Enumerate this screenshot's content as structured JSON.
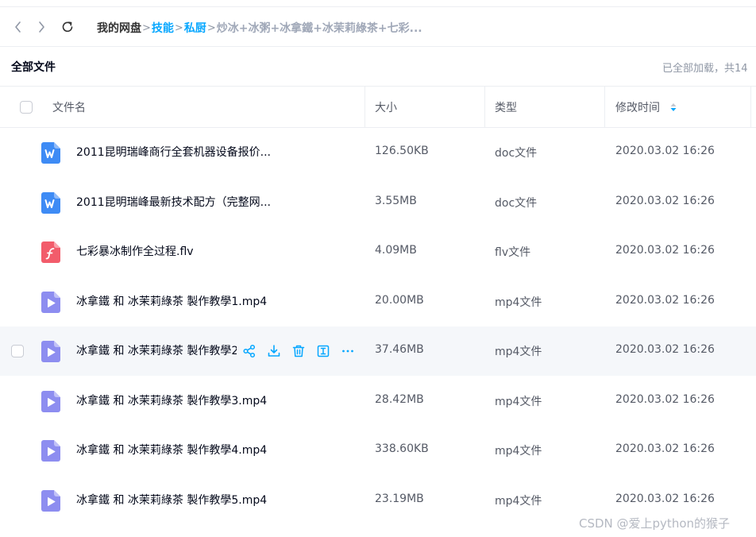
{
  "nav": {
    "back_icon": "chevron-left-icon",
    "forward_icon": "chevron-right-icon",
    "refresh_icon": "refresh-icon",
    "breadcrumb": {
      "root": "我的网盘",
      "sep": ">",
      "level1": "技能",
      "level2": "私厨",
      "current": "炒冰+冰粥+冰拿鐵+冰茉莉綠茶+七彩..."
    }
  },
  "header": {
    "title": "全部文件",
    "status": "已全部加载，共14"
  },
  "table": {
    "columns": {
      "name": "文件名",
      "size": "大小",
      "type": "类型",
      "modified": "修改时间"
    },
    "sort_icon": "sort-updown-icon",
    "rows": [
      {
        "icon": "word-doc-icon",
        "name": "2011昆明瑞峰商行全套机器设备报价...",
        "size": "126.50KB",
        "type": "doc文件",
        "modified": "2020.03.02 16:26"
      },
      {
        "icon": "word-doc-icon",
        "name": "2011昆明瑞峰最新技术配方（完整网...",
        "size": "3.55MB",
        "type": "doc文件",
        "modified": "2020.03.02 16:26"
      },
      {
        "icon": "flash-video-icon",
        "name": "七彩暴冰制作全过程.flv",
        "size": "4.09MB",
        "type": "flv文件",
        "modified": "2020.03.02 16:26"
      },
      {
        "icon": "video-play-icon",
        "name": "冰拿鐵 和 冰茉莉綠茶 製作教學1.mp4",
        "size": "20.00MB",
        "type": "mp4文件",
        "modified": "2020.03.02 16:26"
      },
      {
        "icon": "video-play-icon",
        "name": "冰拿鐵 和 冰茉莉綠茶 製作教學2.mp4",
        "size": "37.46MB",
        "type": "mp4文件",
        "modified": "2020.03.02 16:26"
      },
      {
        "icon": "video-play-icon",
        "name": "冰拿鐵 和 冰茉莉綠茶 製作教學3.mp4",
        "size": "28.42MB",
        "type": "mp4文件",
        "modified": "2020.03.02 16:26"
      },
      {
        "icon": "video-play-icon",
        "name": "冰拿鐵 和 冰茉莉綠茶 製作教學4.mp4",
        "size": "338.60KB",
        "type": "mp4文件",
        "modified": "2020.03.02 16:26"
      },
      {
        "icon": "video-play-icon",
        "name": "冰拿鐵 和 冰茉莉綠茶 製作教學5.mp4",
        "size": "23.19MB",
        "type": "mp4文件",
        "modified": "2020.03.02 16:26"
      }
    ],
    "hover_actions": [
      "share-icon",
      "download-icon",
      "delete-icon",
      "rename-icon",
      "more-icon"
    ]
  },
  "watermark": "CSDN @爱上python的猴子",
  "colors": {
    "accent": "#06a7ff",
    "word": "#3e8bf5",
    "flash": "#f25c6b",
    "video": "#8d8df0",
    "hover_row": "#f5f7fa"
  }
}
